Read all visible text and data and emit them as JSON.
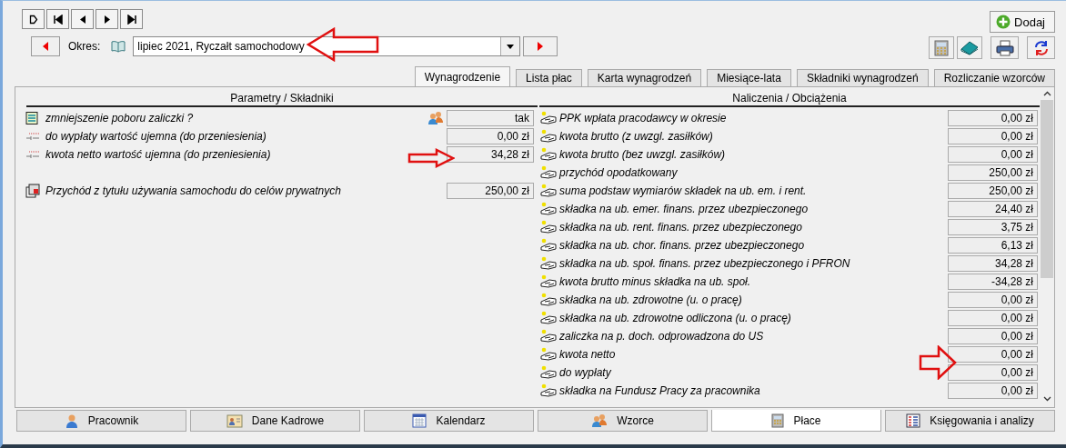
{
  "period": {
    "label": "Okres:",
    "value": "lipiec 2021, Ryczałt samochodowy"
  },
  "add_button": "Dodaj",
  "tabs": [
    {
      "label": "Wynagrodzenie",
      "selected": true
    },
    {
      "label": "Lista płac",
      "selected": false
    },
    {
      "label": "Karta wynagrodzeń",
      "selected": false
    },
    {
      "label": "Miesiące-lata",
      "selected": false
    },
    {
      "label": "Składniki wynagrodzeń",
      "selected": false
    },
    {
      "label": "Rozliczanie wzorców",
      "selected": false
    }
  ],
  "left_panel": {
    "header": "Parametry / Składniki",
    "groups": [
      {
        "rows": [
          {
            "kind": "calc",
            "label": "zmniejszenie poboru zaliczki ?",
            "value": "tak",
            "template_icon": true
          },
          {
            "kind": "param",
            "label": "do wypłaty wartość ujemna (do przeniesienia)",
            "value": "0,00 zł",
            "template_icon": false
          },
          {
            "kind": "param",
            "label": "kwota netto wartość ujemna (do przeniesienia)",
            "value": "34,28 zł",
            "template_icon": false
          }
        ]
      },
      {
        "rows": [
          {
            "kind": "component",
            "label": "Przychód z tytułu używania samochodu do celów prywatnych",
            "value": "250,00 zł",
            "template_icon": false
          }
        ]
      }
    ]
  },
  "right_panel": {
    "header": "Naliczenia / Obciążenia",
    "rows": [
      {
        "label": "PPK wpłata pracodawcy w okresie",
        "value": "0,00 zł"
      },
      {
        "label": "kwota brutto (z uwzgl. zasiłków)",
        "value": "0,00 zł"
      },
      {
        "label": "kwota brutto (bez uwzgl. zasiłków)",
        "value": "0,00 zł"
      },
      {
        "label": "przychód opodatkowany",
        "value": "250,00 zł"
      },
      {
        "label": "suma podstaw wymiarów składek na ub. em. i rent.",
        "value": "250,00 zł"
      },
      {
        "label": "składka na ub. emer. finans. przez ubezpieczonego",
        "value": "24,40 zł"
      },
      {
        "label": "składka na ub. rent. finans. przez ubezpieczonego",
        "value": "3,75 zł"
      },
      {
        "label": "składka na ub. chor. finans. przez ubezpieczonego",
        "value": "6,13 zł"
      },
      {
        "label": "składka na ub. społ. finans. przez ubezpieczonego i PFRON",
        "value": "34,28 zł"
      },
      {
        "label": "kwota brutto minus składka na ub. społ.",
        "value": "-34,28 zł"
      },
      {
        "label": "składka na ub. zdrowotne (u. o pracę)",
        "value": "0,00 zł"
      },
      {
        "label": "składka na ub. zdrowotne odliczona (u. o pracę)",
        "value": "0,00 zł"
      },
      {
        "label": "zaliczka na p. doch. odprowadzona do US",
        "value": "0,00 zł"
      },
      {
        "label": "kwota netto",
        "value": "0,00 zł"
      },
      {
        "label": "do wypłaty",
        "value": "0,00 zł"
      },
      {
        "label": "składka na Fundusz Pracy za pracownika",
        "value": "0,00 zł"
      }
    ]
  },
  "bottom_tabs": [
    {
      "kind": "person",
      "label": "Pracownik",
      "selected": false
    },
    {
      "kind": "card",
      "label": "Dane Kadrowe",
      "selected": false
    },
    {
      "kind": "calendar",
      "label": "Kalendarz",
      "selected": false
    },
    {
      "kind": "group",
      "label": "Wzorce",
      "selected": false
    },
    {
      "kind": "calculator",
      "label": "Płace",
      "selected": true
    },
    {
      "kind": "report",
      "label": "Księgowania i analizy",
      "selected": false
    }
  ]
}
